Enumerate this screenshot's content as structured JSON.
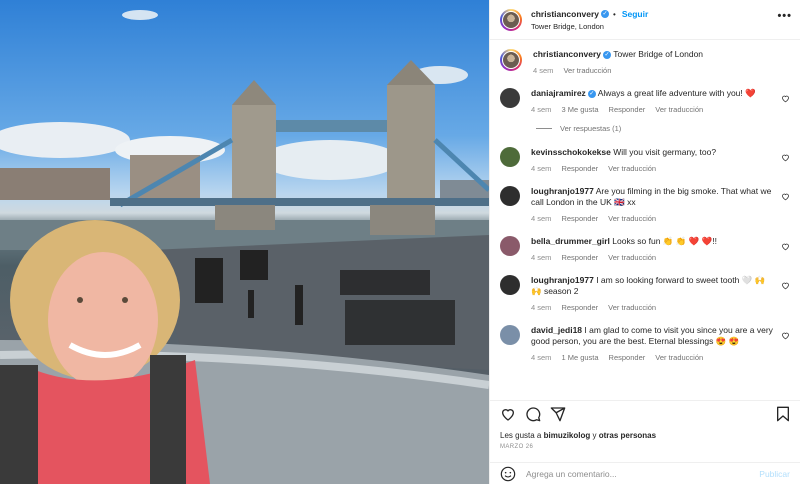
{
  "post": {
    "username": "christianconvery",
    "follow_label": "Seguir",
    "location": "Tower Bridge, London",
    "caption": "Tower Bridge of London",
    "caption_time": "4 sem",
    "translate_label": "Ver traducción"
  },
  "comments": [
    {
      "user": "daniajramirez",
      "verified": true,
      "text": "Always a great life adventure with you! ❤️",
      "time": "4 sem",
      "likes": "3 Me gusta",
      "reply": "Responder",
      "translate": "Ver traducción",
      "avatar_color": "#3a3a3a"
    },
    {
      "user": "kevinsschokokekse",
      "verified": false,
      "text": "Will you visit germany, too?",
      "time": "4 sem",
      "likes": "",
      "reply": "Responder",
      "translate": "Ver traducción",
      "avatar_color": "#4e6b3a"
    },
    {
      "user": "loughranjo1977",
      "verified": false,
      "text": "Are you filming in the big smoke. That what we call London in the UK 🇬🇧 xx",
      "time": "4 sem",
      "likes": "",
      "reply": "Responder",
      "translate": "Ver traducción",
      "avatar_color": "#2e2e2e"
    },
    {
      "user": "bella_drummer_girl",
      "verified": false,
      "text": "Looks so fun 👏 👏 ❤️ ❤️!!",
      "time": "4 sem",
      "likes": "",
      "reply": "Responder",
      "translate": "Ver traducción",
      "avatar_color": "#8a5a6a"
    },
    {
      "user": "loughranjo1977",
      "verified": false,
      "text": "I am so looking forward to sweet tooth 🤍 🙌 🙌 season 2",
      "time": "4 sem",
      "likes": "",
      "reply": "Responder",
      "translate": "Ver traducción",
      "avatar_color": "#2e2e2e"
    },
    {
      "user": "david_jedi18",
      "verified": false,
      "text": "I am glad to come to visit you since you are a very good person, you are the best. Eternal blessings 😍 😍",
      "time": "4 sem",
      "likes": "1 Me gusta",
      "reply": "Responder",
      "translate": "Ver traducción",
      "avatar_color": "#7a8fa8"
    }
  ],
  "view_replies": "Ver respuestas (1)",
  "liked_by": {
    "prefix": "Les gusta a ",
    "user": "bimuzikolog",
    "suffix": " y ",
    "others": "otras personas"
  },
  "post_date": "MARZO 26",
  "add_comment": {
    "placeholder": "Agrega un comentario...",
    "publish": "Publicar"
  },
  "icons": {
    "like": "heart-icon",
    "comment": "comment-icon",
    "share": "share-icon",
    "save": "bookmark-icon",
    "emoji": "emoji-icon",
    "more": "more-icon"
  },
  "colors": {
    "accent": "#0095f6",
    "verified": "#3897f0",
    "heart": "#ed4956"
  }
}
